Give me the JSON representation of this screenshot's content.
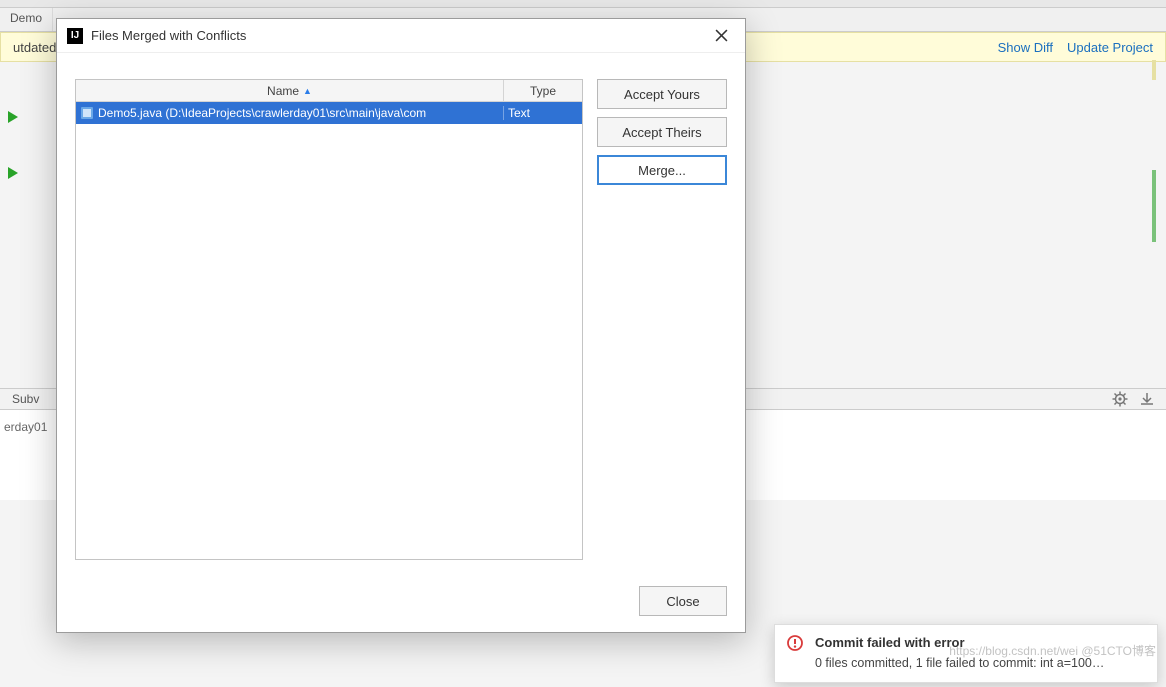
{
  "background": {
    "editor_tabs": {
      "demo": "Demo"
    },
    "outdated_prefix": "utdated",
    "links": {
      "show_diff": "Show Diff",
      "update_project": "Update Project"
    },
    "bottom_tool": "Subv",
    "log_line": "erday01",
    "gear_tip": "settings",
    "download_tip": "download"
  },
  "dialog": {
    "title": "Files Merged with Conflicts",
    "columns": {
      "name": "Name",
      "type": "Type"
    },
    "rows": [
      {
        "file_icon": "java-file-icon",
        "name": "Demo5.java (D:\\IdeaProjects\\crawlerday01\\src\\main\\java\\com",
        "type": "Text"
      }
    ],
    "buttons": {
      "accept_yours": "Accept Yours",
      "accept_theirs": "Accept Theirs",
      "merge": "Merge...",
      "close": "Close"
    }
  },
  "notification": {
    "title": "Commit failed with error",
    "message": "0 files committed, 1 file failed to commit: int a=100…"
  },
  "watermark": "https://blog.csdn.net/wei @51CTO博客"
}
